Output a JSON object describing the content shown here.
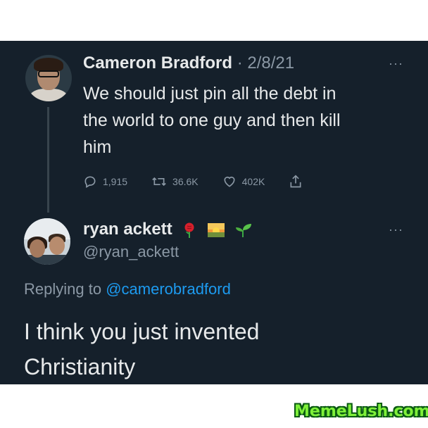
{
  "tweet": {
    "author": "Cameron Bradford",
    "separator": "·",
    "date": "2/8/21",
    "more": "···",
    "text_lines": [
      "We should just pin all the debt in",
      "the world to one guy and then kill",
      "him"
    ],
    "actions": {
      "replies": "1,915",
      "retweets": "36.6K",
      "likes": "402K"
    }
  },
  "reply": {
    "author": "ryan ackett",
    "author_emojis": [
      "rose",
      "sunrise",
      "seedling"
    ],
    "handle": "@ryan_ackett",
    "more": "···",
    "replying_prefix": "Replying to",
    "replying_handle": "@camerobradford",
    "text_lines": [
      "I think you just invented",
      "Christianity"
    ]
  },
  "watermark": "MemeLush.com",
  "colors": {
    "background": "#15202b",
    "text": "#e7e9ea",
    "muted": "#8b98a5",
    "link": "#1d9bf0"
  }
}
